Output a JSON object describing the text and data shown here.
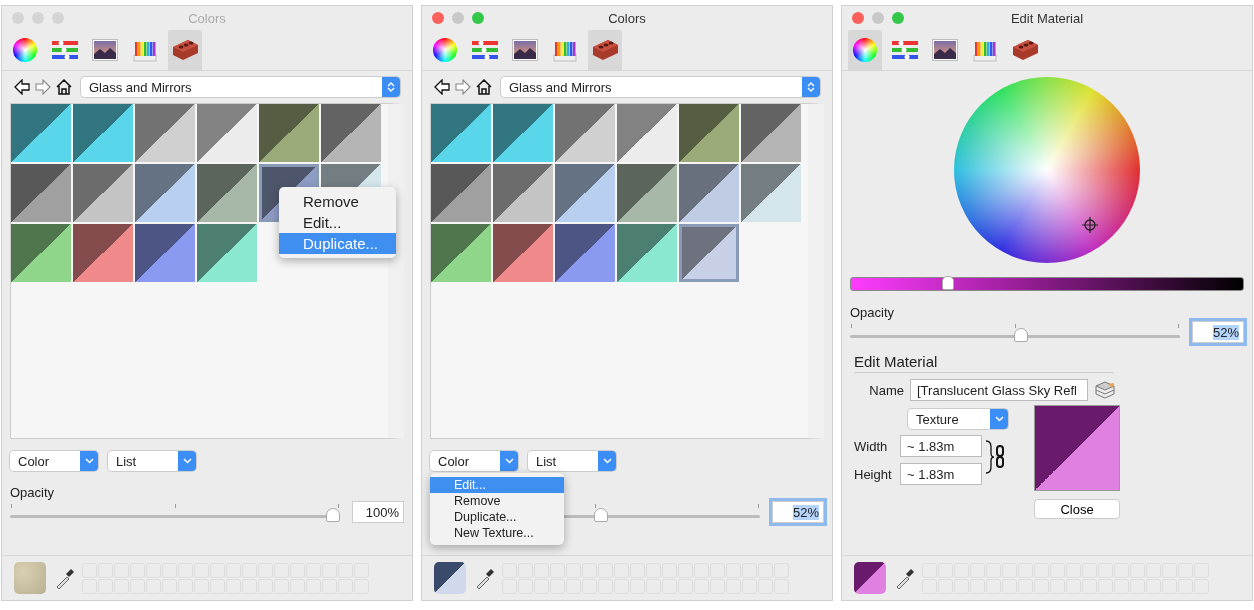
{
  "panels": [
    {
      "kind": "browser",
      "title": "Colors",
      "active": false,
      "tabs": [
        {
          "kind": "wheel",
          "selected": false
        },
        {
          "kind": "sliders",
          "selected": false
        },
        {
          "kind": "image",
          "selected": false
        },
        {
          "kind": "pencils",
          "selected": false
        },
        {
          "kind": "brick",
          "selected": true
        }
      ],
      "collection": "Glass and Mirrors",
      "swatches": [
        {
          "color": "#5ad6ea",
          "selected": false
        },
        {
          "color": "#5ad6ea",
          "selected": false
        },
        {
          "color": "#d0d0d0",
          "selected": false
        },
        {
          "color": "#ececec",
          "selected": false
        },
        {
          "color": "#9aaa78",
          "selected": false
        },
        {
          "color": "#b4b4b4",
          "selected": false
        },
        {
          "color": "#a0a0a0",
          "selected": false
        },
        {
          "color": "#c4c4c4",
          "selected": false
        },
        {
          "color": "#b8cff0",
          "selected": false
        },
        {
          "color": "#a8b8a8",
          "selected": false
        },
        {
          "color": "#8e9cc4",
          "selected": true
        },
        {
          "color": "#d4e6ec",
          "selected": false
        },
        {
          "color": "#8fd68a",
          "selected": false
        },
        {
          "color": "#f08a8a",
          "selected": false
        },
        {
          "color": "#8a9af0",
          "selected": false
        },
        {
          "color": "#8ae8d0",
          "selected": false
        }
      ],
      "context_menu": {
        "kind": "swatch",
        "items": [
          {
            "label": "Remove",
            "selected": false
          },
          {
            "label": "Edit...",
            "selected": false
          },
          {
            "label": "Duplicate...",
            "selected": true
          }
        ]
      },
      "dropdowns": [
        "Color",
        "List"
      ],
      "opacity": {
        "label": "Opacity",
        "level": 1.0,
        "reading": "100%",
        "focused": false
      }
    },
    {
      "kind": "browser",
      "title": "Colors",
      "active": true,
      "tabs": [
        {
          "kind": "wheel",
          "selected": false
        },
        {
          "kind": "sliders",
          "selected": false
        },
        {
          "kind": "image",
          "selected": false
        },
        {
          "kind": "pencils",
          "selected": false
        },
        {
          "kind": "brick",
          "selected": true
        }
      ],
      "collection": "Glass and Mirrors",
      "swatches": [
        {
          "color": "#5ad6ea",
          "selected": false
        },
        {
          "color": "#5ad6ea",
          "selected": false
        },
        {
          "color": "#d0d0d0",
          "selected": false
        },
        {
          "color": "#ececec",
          "selected": false
        },
        {
          "color": "#9aaa78",
          "selected": false
        },
        {
          "color": "#b4b4b4",
          "selected": false
        },
        {
          "color": "#a0a0a0",
          "selected": false
        },
        {
          "color": "#c4c4c4",
          "selected": false
        },
        {
          "color": "#b8cff0",
          "selected": false
        },
        {
          "color": "#a8b8a8",
          "selected": false
        },
        {
          "color": "#c0cce4",
          "selected": false
        },
        {
          "color": "#d4e6ec",
          "selected": false
        },
        {
          "color": "#8fd68a",
          "selected": false
        },
        {
          "color": "#f08a8a",
          "selected": false
        },
        {
          "color": "#8a9af0",
          "selected": false
        },
        {
          "color": "#8ae8d0",
          "selected": false
        },
        {
          "color": "#c8d0e8",
          "selected": true
        }
      ],
      "context_menu": {
        "kind": "dropdown",
        "items": [
          {
            "label": "Edit...",
            "selected": true
          },
          {
            "label": "Remove",
            "selected": false
          },
          {
            "label": "Duplicate...",
            "selected": false
          },
          {
            "label": "New Texture...",
            "selected": false
          }
        ]
      },
      "dropdowns": [
        "Color",
        "List"
      ],
      "opacity": {
        "level": 0.52,
        "reading": "52%",
        "focused": true
      }
    },
    {
      "kind": "editor",
      "title": "Edit Material",
      "active": true,
      "tabs": [
        {
          "kind": "wheel",
          "selected": true
        },
        {
          "kind": "sliders",
          "selected": false
        },
        {
          "kind": "image",
          "selected": false
        },
        {
          "kind": "pencils",
          "selected": false
        },
        {
          "kind": "brick",
          "selected": false
        }
      ],
      "brightness": {
        "level": 0.24
      },
      "opacity": {
        "label": "Opacity",
        "level": 0.52,
        "reading": "52%",
        "focused": true
      },
      "edit": {
        "heading": "Edit Material",
        "name_label": "Name",
        "name_value": "[Translucent Glass Sky Refl",
        "type": "Texture",
        "width_label": "Width",
        "width_value": "~ 1.83m",
        "height_label": "Height",
        "height_value": "~ 1.83m",
        "close": "Close"
      }
    }
  ]
}
